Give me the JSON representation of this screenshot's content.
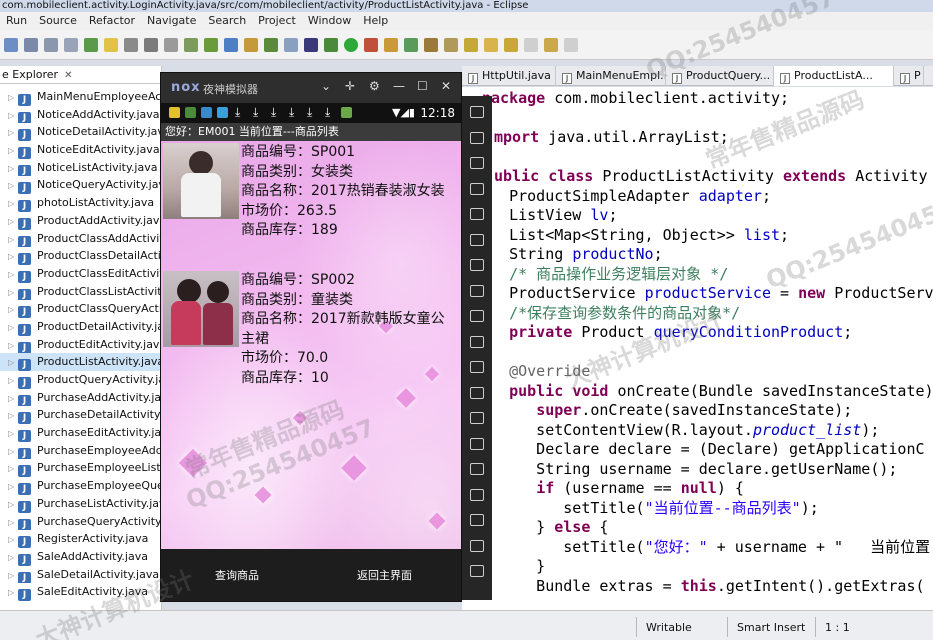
{
  "window": {
    "title": "com.mobileclient.activity.LoginActivity.java/src/com/mobileclient/activity/ProductListActivity.java - Eclipse"
  },
  "menu": [
    "Run",
    "Source",
    "Refactor",
    "Navigate",
    "Search",
    "Project",
    "Window",
    "Help"
  ],
  "package_explorer": {
    "tab_label": "e Explorer",
    "close": "✕",
    "selected_index": 13,
    "items": [
      "MainMenuEmployeeActi",
      "NoticeAddActivity.java",
      "NoticeDetailActivity.java",
      "NoticeEditActivity.java",
      "NoticeListActivity.java",
      "NoticeQueryActivity.java",
      "photoListActivity.java",
      "ProductAddActivity.java",
      "ProductClassAddActivity",
      "ProductClassDetailActiv",
      "ProductClassEditActivity",
      "ProductClassListActivity",
      "ProductClassQueryActiv",
      "ProductDetailActivity.java",
      "ProductEditActivity.java",
      "ProductListActivity.java",
      "ProductQueryActivity.java",
      "PurchaseAddActivity.java",
      "PurchaseDetailActivity.java",
      "PurchaseEditActivity.java",
      "PurchaseEmployeeAddA",
      "PurchaseEmployeeListA",
      "PurchaseEmployeeQuer",
      "PurchaseListActivity.java",
      "PurchaseQueryActivity.java",
      "RegisterActivity.java",
      "SaleAddActivity.java",
      "SaleDetailActivity.java",
      "SaleEditActivity.java"
    ]
  },
  "editor_tabs": [
    {
      "label": "HttpUtil.java",
      "active": false
    },
    {
      "label": "MainMenuEmpl...",
      "active": false
    },
    {
      "label": "ProductQuery...",
      "active": false
    },
    {
      "label": "ProductListA...",
      "active": true
    },
    {
      "label": "P",
      "active": false
    }
  ],
  "code": [
    "package com.mobileclient.activity;",
    "",
    "mport java.util.ArrayList;",
    "",
    "ublic class ProductListActivity extends Activity {",
    "   ProductSimpleAdapter adapter;",
    "   ListView lv;",
    "   List<Map<String, Object>> list;",
    "   String productNo;",
    "   /* 商品操作业务逻辑层对象 */",
    "   ProductService productService = new ProductServ",
    "   /*保存查询参数条件的商品对象*/",
    "   private Product queryConditionProduct;",
    "",
    "   @Override",
    "   public void onCreate(Bundle savedInstanceState)",
    "      super.onCreate(savedInstanceState);",
    "      setContentView(R.layout.product_list);",
    "      Declare declare = (Declare) getApplicationC",
    "      String username = declare.getUserName();",
    "      if (username == null) {",
    "         setTitle(\"当前位置--商品列表\");",
    "      } else {",
    "         setTitle(\"您好：\" + username + \"   当前位置",
    "      }",
    "      Bundle extras = this.getIntent().getExtras("
  ],
  "status_bar": {
    "mode": "Writable",
    "insert": "Smart Insert",
    "position": "1 : 1"
  },
  "emulator": {
    "logo": "nox",
    "name": "夜神模拟器",
    "clock": "12:18",
    "action_bar_title": "您好：EM001  当前位置---商品列表",
    "products": [
      {
        "no": "商品编号：SP001",
        "category": "商品类别：女装类",
        "name": "商品名称：2017热销春装淑女装",
        "price": "市场价：263.5",
        "stock": "商品库存：189"
      },
      {
        "no": "商品编号：SP002",
        "category": "商品类别：童装类",
        "name": "商品名称：2017新款韩版女童公主裙",
        "price": "市场价：70.0",
        "stock": "商品库存：10"
      }
    ],
    "buttons": {
      "query": "查询商品",
      "back": "返回主界面"
    }
  },
  "watermark": {
    "qq": "QQ:254540457",
    "text1": "常年售精品源码",
    "text2": "大神计算机设计"
  }
}
